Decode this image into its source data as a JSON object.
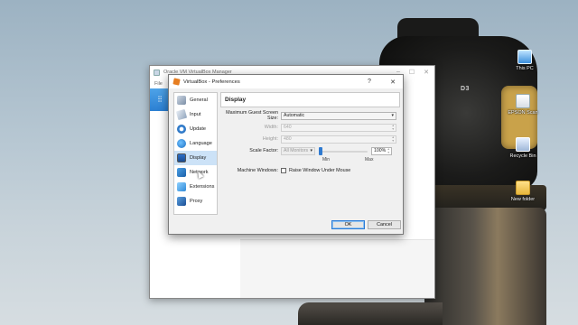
{
  "desktop": {
    "icons": [
      {
        "label": "This PC",
        "icon": "computer-icon"
      },
      {
        "label": "EPSON Scan",
        "icon": "scanner-icon"
      },
      {
        "label": "Recycle Bin",
        "icon": "recycle-bin-icon"
      },
      {
        "label": "New folder",
        "icon": "folder-icon"
      }
    ],
    "wallpaper_brand": "D3"
  },
  "manager": {
    "title": "Oracle VM VirtualBox Manager",
    "menu_file": "File",
    "controls": [
      "–",
      "☐",
      "✕"
    ]
  },
  "dialog": {
    "title": "VirtualBox - Preferences",
    "help": "?",
    "close": "✕",
    "nav": [
      {
        "label": "General",
        "icon": "general-icon"
      },
      {
        "label": "Input",
        "icon": "input-icon"
      },
      {
        "label": "Update",
        "icon": "update-icon"
      },
      {
        "label": "Language",
        "icon": "language-icon"
      },
      {
        "label": "Display",
        "icon": "display-icon",
        "active": true
      },
      {
        "label": "Network",
        "icon": "network-icon"
      },
      {
        "label": "Extensions",
        "icon": "extensions-icon"
      },
      {
        "label": "Proxy",
        "icon": "proxy-icon"
      }
    ],
    "page_title": "Display",
    "max_screen_size": {
      "label": "Maximum Guest Screen Size:",
      "value": "Automatic"
    },
    "width": {
      "label": "Width:",
      "value": "640"
    },
    "height": {
      "label": "Height:",
      "value": "480"
    },
    "scale_factor": {
      "label": "Scale Factor:",
      "monitors": "All Monitors",
      "percent": "100%",
      "level": 0,
      "min_label": "Min",
      "max_label": "Max"
    },
    "machine_windows": {
      "label": "Machine Windows:",
      "checkbox_label": "Raise Window Under Mouse",
      "checked": false
    },
    "ok": "OK",
    "cancel": "Cancel"
  },
  "colors": {
    "accent": "#2f7ad0",
    "selected_nav": "#cce2f7"
  }
}
